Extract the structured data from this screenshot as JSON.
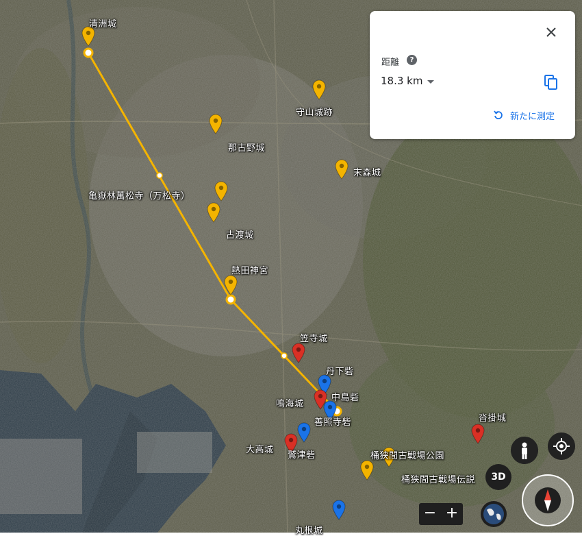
{
  "panel": {
    "distance_label": "距離",
    "help_icon": "?",
    "distance_value": "18.3 km",
    "remeasure_label": "新たに測定"
  },
  "places": [
    {
      "name": "清洲城"
    },
    {
      "name": "守山城跡"
    },
    {
      "name": "那古野城"
    },
    {
      "name": "末森城"
    },
    {
      "name": "亀嶽林萬松寺（万松寺）"
    },
    {
      "name": "古渡城"
    },
    {
      "name": "熱田神宮"
    },
    {
      "name": "笠寺城"
    },
    {
      "name": "丹下砦"
    },
    {
      "name": "鳴海城"
    },
    {
      "name": "中島砦"
    },
    {
      "name": "善照寺砦"
    },
    {
      "name": "沓掛城"
    },
    {
      "name": "大高城"
    },
    {
      "name": "鷲津砦"
    },
    {
      "name": "桶狭間古戦場公園"
    },
    {
      "name": "桶狭間古戦場伝説"
    },
    {
      "name": "丸根城"
    }
  ],
  "controls": {
    "btn_3d": "3D",
    "zoom_out": "−",
    "zoom_in": "+"
  },
  "colors": {
    "route": "#f4b400",
    "pin_yellow": "#f4b400",
    "pin_red": "#d93025",
    "pin_blue": "#1a73e8",
    "link": "#1a73e8"
  },
  "icons": [
    "close-icon",
    "help-icon",
    "chevron-down-icon",
    "copy-icon",
    "refresh-icon",
    "pegman-icon",
    "my-location-icon",
    "globe-icon",
    "compass-icon"
  ]
}
